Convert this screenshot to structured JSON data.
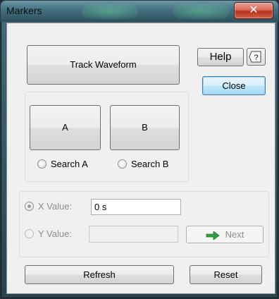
{
  "window": {
    "title": "Markers"
  },
  "buttons": {
    "track_waveform": "Track Waveform",
    "help": "Help",
    "close": "Close",
    "marker_a": "A",
    "marker_b": "B",
    "next": "Next",
    "refresh": "Refresh",
    "reset": "Reset"
  },
  "search": {
    "a_label": "Search A",
    "b_label": "Search B"
  },
  "values": {
    "x_label": "X Value:",
    "x_value": "0 s",
    "y_label": "Y Value:",
    "y_value": ""
  },
  "icons": {
    "close": "close-icon",
    "help": "context-help-icon",
    "next": "green-arrow-icon"
  },
  "colors": {
    "accent_close": "#c9422b",
    "default_button_border": "#3c7fb1",
    "arrow_green": "#2ea043"
  }
}
